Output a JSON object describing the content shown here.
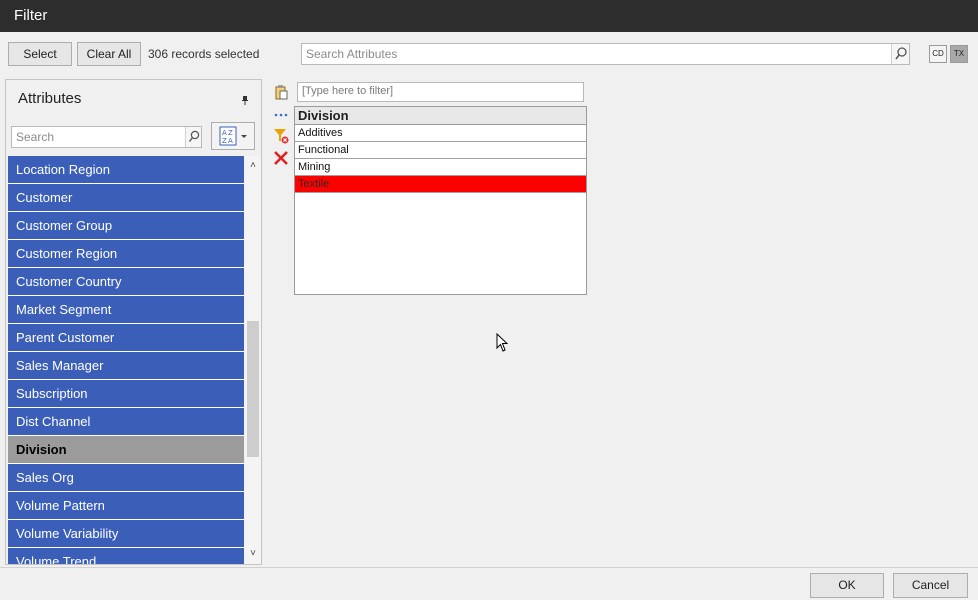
{
  "window": {
    "title": "Filter"
  },
  "toolbar": {
    "select_label": "Select",
    "clear_all_label": "Clear All",
    "status": "306 records selected",
    "search_placeholder": "Search Attributes",
    "toggle_cd": "CD",
    "toggle_tx": "TX"
  },
  "attributes": {
    "title": "Attributes",
    "search_placeholder": "Search",
    "items": [
      {
        "label": "Location Region",
        "selected": false
      },
      {
        "label": "Customer",
        "selected": false
      },
      {
        "label": "Customer Group",
        "selected": false
      },
      {
        "label": "Customer Region",
        "selected": false
      },
      {
        "label": "Customer Country",
        "selected": false
      },
      {
        "label": "Market Segment",
        "selected": false
      },
      {
        "label": "Parent Customer",
        "selected": false
      },
      {
        "label": "Sales Manager",
        "selected": false
      },
      {
        "label": "Subscription",
        "selected": false
      },
      {
        "label": "Dist Channel",
        "selected": false
      },
      {
        "label": "Division",
        "selected": true
      },
      {
        "label": "Sales Org",
        "selected": false
      },
      {
        "label": "Volume Pattern",
        "selected": false
      },
      {
        "label": "Volume Variability",
        "selected": false
      },
      {
        "label": "Volume Trend",
        "selected": false
      }
    ]
  },
  "filter": {
    "placeholder": "[Type here to filter]",
    "column_header": "Division",
    "rows": [
      {
        "label": "Additives",
        "highlighted": false
      },
      {
        "label": "Functional",
        "highlighted": false
      },
      {
        "label": "Mining",
        "highlighted": false
      },
      {
        "label": "Textile",
        "highlighted": true
      }
    ]
  },
  "footer": {
    "ok_label": "OK",
    "cancel_label": "Cancel"
  },
  "colors": {
    "list_item": "#3b5fb8",
    "list_selected": "#9b9b9b",
    "highlight_row": "#ff0000",
    "titlebar": "#2d2d2d"
  }
}
